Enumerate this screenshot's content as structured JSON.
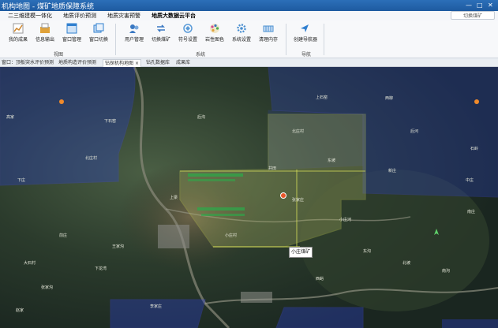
{
  "titlebar": {
    "title": "机构地图 - 煤矿地质保障系统",
    "minimize": "—",
    "maximize": "□",
    "close": "✕"
  },
  "menu": {
    "tabs": [
      "二三维建模一体化",
      "地质评价预测",
      "地质灾害预警",
      "地质大数据云平台"
    ],
    "active_index": 3,
    "switch_label": "切换煤矿"
  },
  "ribbon": {
    "tools": [
      {
        "label": "我的成果",
        "icon": "chart-icon",
        "color": "#d0862b"
      },
      {
        "label": "信息输出",
        "icon": "export-icon",
        "color": "#e0a23a"
      },
      {
        "label": "窗口管理",
        "icon": "window-icon",
        "color": "#2f7fcf"
      },
      {
        "label": "窗口切换",
        "icon": "window-switch-icon",
        "color": "#2f7fcf"
      },
      {
        "label": "用户管理",
        "icon": "users-icon",
        "color": "#3a78c2"
      },
      {
        "label": "切换煤矿",
        "icon": "switch-mine-icon",
        "color": "#3a78c2"
      },
      {
        "label": "符号设置",
        "icon": "symbol-icon",
        "color": "#5a9bd8"
      },
      {
        "label": "岩性图色",
        "icon": "palette-icon",
        "color": "#d14b8f"
      },
      {
        "label": "系统设置",
        "icon": "gear-icon",
        "color": "#4a8fd0"
      },
      {
        "label": "清理内存",
        "icon": "memory-icon",
        "color": "#4a8fd0"
      },
      {
        "label": "创建导航器",
        "icon": "navigator-icon",
        "color": "#2f7fcf"
      }
    ],
    "groups": [
      "视图",
      "系统",
      "导航"
    ]
  },
  "doc_tabs": {
    "items": [
      "窗口：顶板突水评价预测",
      "地质构造评价预测",
      "钻探机构地图",
      "钻孔数据库",
      "成果库"
    ],
    "active_index": 2,
    "close_glyph": "×"
  },
  "map": {
    "callout": "小庄煤矿",
    "labels": [
      "下庄",
      "北庄村",
      "小庄村",
      "张家庄",
      "下石窑",
      "北庄村",
      "上石窑",
      "西柳",
      "东坡",
      "井田",
      "后河",
      "石岭",
      "新庄",
      "小庄河",
      "南庄",
      "前庄",
      "大石村",
      "王家沟",
      "张家沟",
      "下龙湾",
      "上梁",
      "东沟",
      "北坡",
      "南沟",
      "西峪",
      "李家庄",
      "赵家",
      "中庄",
      "高家",
      "后沟"
    ],
    "accent": "#d8e05a",
    "boundary_color": "#3b44d6"
  }
}
